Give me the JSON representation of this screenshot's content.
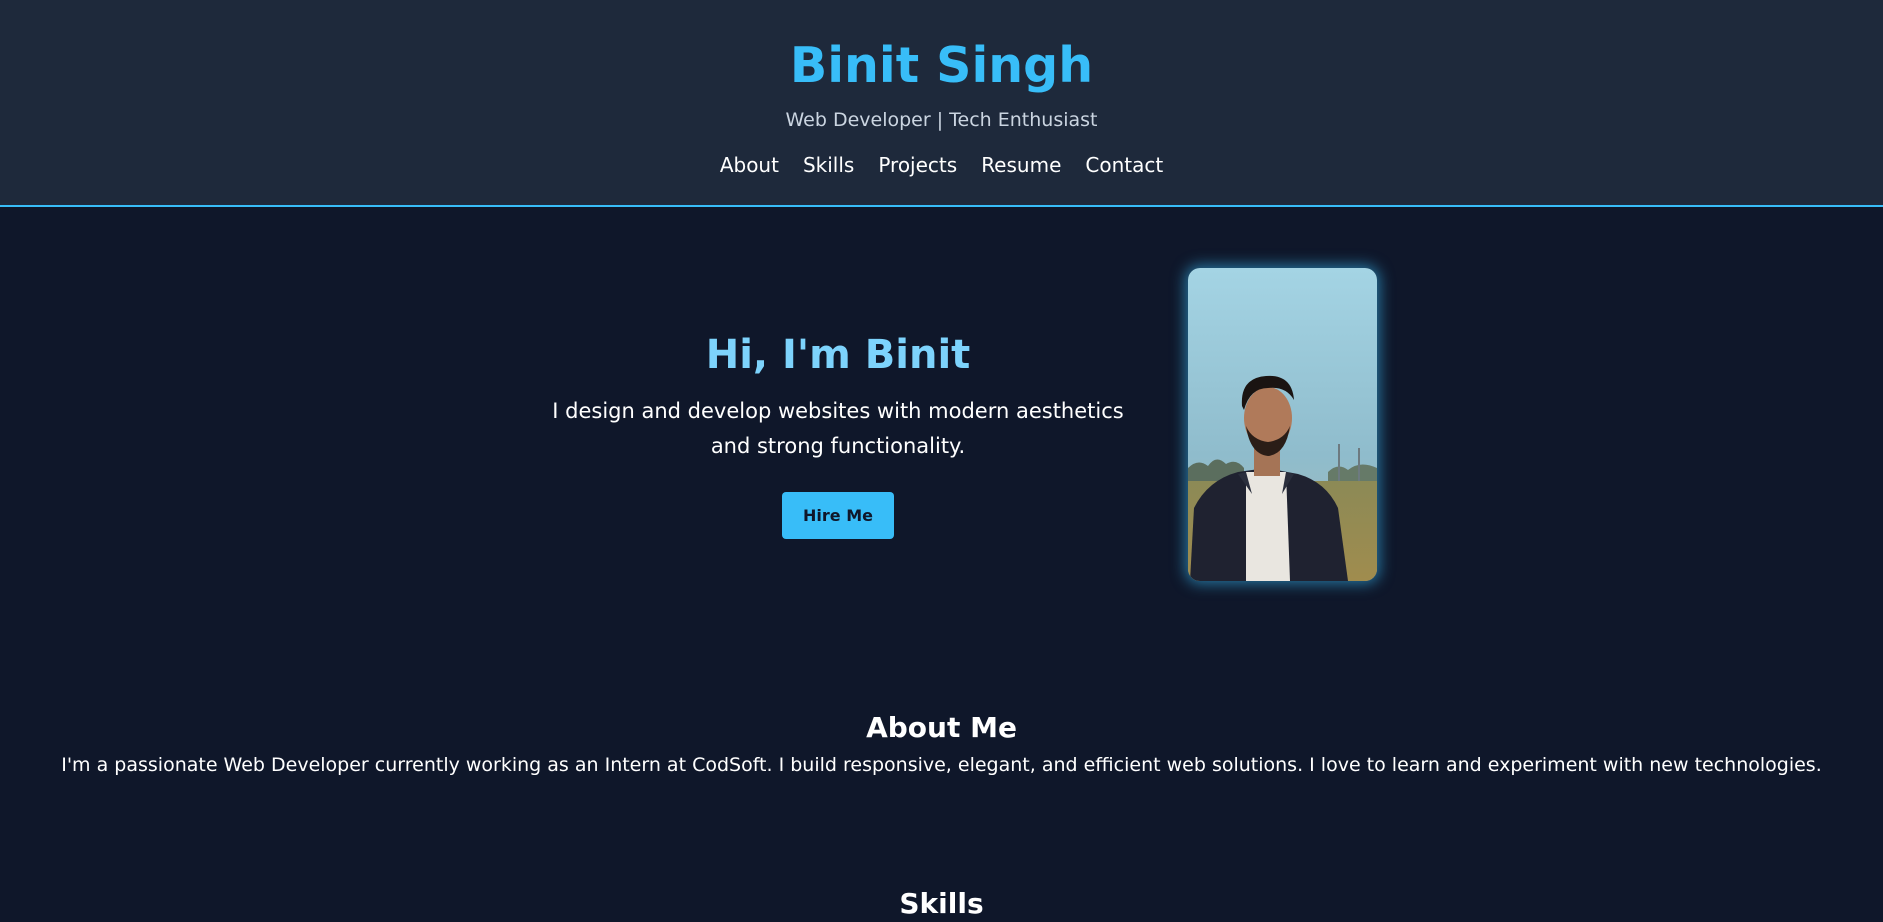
{
  "header": {
    "title": "Binit Singh",
    "tagline": "Web Developer | Tech Enthusiast",
    "nav": [
      "About",
      "Skills",
      "Projects",
      "Resume",
      "Contact"
    ]
  },
  "hero": {
    "heading": "Hi, I'm Binit",
    "description": "I design and develop websites with modern aesthetics and strong functionality.",
    "button_label": "Hire Me"
  },
  "about": {
    "heading": "About Me",
    "text": "I'm a passionate Web Developer currently working as an Intern at CodSoft. I build responsive, elegant, and efficient web solutions. I love to learn and experiment with new technologies."
  },
  "skills": {
    "heading": "Skills"
  },
  "colors": {
    "accent": "#38bdf8",
    "background": "#0f172a",
    "header_background": "#1e293b"
  }
}
